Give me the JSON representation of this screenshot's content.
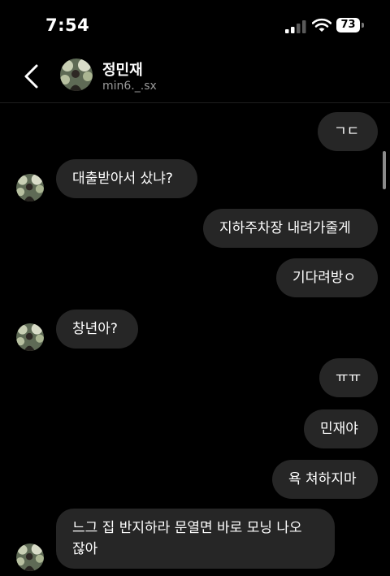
{
  "status_bar": {
    "time": "7:54",
    "battery": "73"
  },
  "header": {
    "name": "정민재",
    "handle": "min6._.sx"
  },
  "messages": [
    {
      "from": "me",
      "text": "ㄱㄷ"
    },
    {
      "from": "them",
      "text": "대출받아서 샀냐?"
    },
    {
      "from": "me",
      "text": "지하주차장 내려가줄게"
    },
    {
      "from": "me",
      "text": "기다려방ㅇ"
    },
    {
      "from": "them",
      "text": "창년아?"
    },
    {
      "from": "me",
      "text": "ㅠㅠ"
    },
    {
      "from": "me",
      "text": "민재야"
    },
    {
      "from": "me",
      "text": "욕 쳐하지마"
    },
    {
      "from": "them",
      "text": "느그 집 반지하라 문열면 바로 모닝 나오 잖아"
    }
  ],
  "colors": {
    "background": "#000000",
    "bubble": "#262626",
    "secondary_text": "#9a9a9a"
  },
  "icons": {
    "back": "chevron-left-icon",
    "signal": "cellular-signal-icon",
    "wifi": "wifi-icon",
    "battery": "battery-icon"
  }
}
